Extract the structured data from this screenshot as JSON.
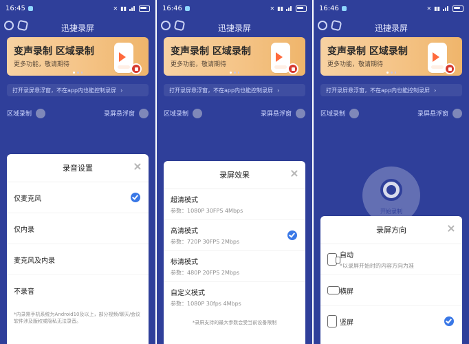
{
  "screens": [
    {
      "status": {
        "time": "16:45"
      },
      "app_title": "迅捷录屏",
      "banner": {
        "title": "变声录制 区域录制",
        "subtitle": "更多功能，敬请期待"
      },
      "hint": "打开录屏悬浮窗，不在app内也能控制录屏",
      "left_toggle_label": "区域录制",
      "right_toggle_label": "录屏悬浮窗",
      "sheet": {
        "title": "录音设置",
        "options": [
          {
            "label": "仅麦克风",
            "checked": true
          },
          {
            "label": "仅内录",
            "checked": false
          },
          {
            "label": "麦克风及内录",
            "checked": false
          },
          {
            "label": "不录音",
            "checked": false
          }
        ],
        "footnote": "*内录需手机系统为Android10及以上，部分视频/聊天/会议软件涉及版权或隐私无法录音。"
      }
    },
    {
      "status": {
        "time": "16:46"
      },
      "app_title": "迅捷录屏",
      "banner": {
        "title": "变声录制 区域录制",
        "subtitle": "更多功能，敬请期待"
      },
      "hint": "打开录屏悬浮窗，不在app内也能控制录屏",
      "left_toggle_label": "区域录制",
      "right_toggle_label": "录屏悬浮窗",
      "sheet": {
        "title": "录屏效果",
        "options": [
          {
            "label": "超清模式",
            "sub": "参数：1080P 30FPS 4Mbps",
            "checked": false
          },
          {
            "label": "高清模式",
            "sub": "参数：720P 30FPS 2Mbps",
            "checked": true
          },
          {
            "label": "标清模式",
            "sub": "参数：480P 20FPS 2Mbps",
            "checked": false
          },
          {
            "label": "自定义模式",
            "sub": "参数：1080P 30fps 4Mbps",
            "checked": false
          }
        ],
        "footnote": "*录屏支持的最大参数会受当前设备限制"
      }
    },
    {
      "status": {
        "time": "16:46"
      },
      "app_title": "迅捷录屏",
      "banner": {
        "title": "变声录制 区域录制",
        "subtitle": "更多功能，敬请期待"
      },
      "hint": "打开录屏悬浮窗，不在app内也能控制录屏",
      "left_toggle_label": "区域录制",
      "right_toggle_label": "录屏悬浮窗",
      "start_record_label": "开始录制",
      "sheet": {
        "title": "录屏方向",
        "options": [
          {
            "label": "自动",
            "sub": "*以录屏开始时的内容方向为准",
            "icon": "auto-orientation-icon",
            "checked": false
          },
          {
            "label": "横屏",
            "icon": "landscape-icon",
            "checked": false
          },
          {
            "label": "竖屏",
            "icon": "portrait-icon",
            "checked": true
          }
        ]
      }
    }
  ],
  "colors": {
    "app_bg": "#2f3f9a",
    "accent": "#3a78e6"
  }
}
